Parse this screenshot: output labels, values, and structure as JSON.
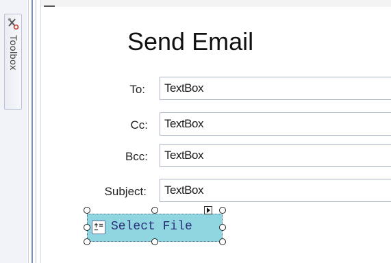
{
  "toolbox": {
    "label": "Toolbox",
    "icon": "tools-icon"
  },
  "form": {
    "title": "Send Email",
    "fields": [
      {
        "label": "To:",
        "value": "TextBox"
      },
      {
        "label": "Cc:",
        "value": "TextBox"
      },
      {
        "label": "Bcc:",
        "value": "TextBox"
      },
      {
        "label": "Subject:",
        "value": "TextBox"
      }
    ],
    "select_file_label": "Select File"
  },
  "colors": {
    "button_bg": "#8fd6e0",
    "button_text": "#2b2f7a",
    "separator_accent": "#7d8fb5"
  }
}
